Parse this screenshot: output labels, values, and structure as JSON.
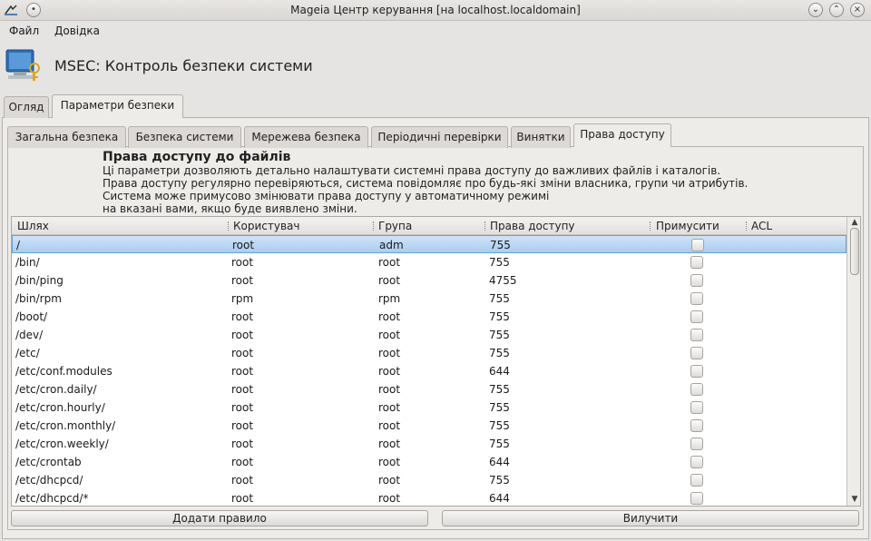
{
  "window": {
    "title": "Mageia Центр керування  [на localhost.localdomain]",
    "controls": [
      "chevron-down-icon",
      "chevron-up-icon",
      "close-icon"
    ]
  },
  "menu": {
    "file": "Файл",
    "help": "Довідка"
  },
  "header": {
    "title": "MSEC: Контроль безпеки системи"
  },
  "outer_tabs": [
    {
      "label": "Огляд"
    },
    {
      "label": "Параметри безпеки"
    }
  ],
  "inner_tabs": [
    {
      "label": "Загальна безпека"
    },
    {
      "label": "Безпека системи"
    },
    {
      "label": "Мережева безпека"
    },
    {
      "label": "Періодичні перевірки"
    },
    {
      "label": "Винятки"
    },
    {
      "label": "Права доступу"
    }
  ],
  "description": {
    "title": "Права доступу до файлів",
    "lines": [
      "Ці параметри дозволяють детально налаштувати системні права доступу до важливих файлів і каталогів.",
      "Права доступу регулярно перевіряються, система повідомляє про будь-які зміни власника, групи чи атрибутів.",
      "Система може примусово змінювати права доступу у автоматичному режимі",
      "на вказані вами, якщо буде виявлено зміни."
    ]
  },
  "table": {
    "columns": [
      "Шлях",
      "Користувач",
      "Група",
      "Права доступу",
      "Примусити",
      "ACL"
    ],
    "rows": [
      {
        "path": "/",
        "user": "root",
        "group": "adm",
        "perm": "755",
        "force": false,
        "acl": ""
      },
      {
        "path": "/bin/",
        "user": "root",
        "group": "root",
        "perm": "755",
        "force": false,
        "acl": ""
      },
      {
        "path": "/bin/ping",
        "user": "root",
        "group": "root",
        "perm": "4755",
        "force": false,
        "acl": ""
      },
      {
        "path": "/bin/rpm",
        "user": "rpm",
        "group": "rpm",
        "perm": "755",
        "force": false,
        "acl": ""
      },
      {
        "path": "/boot/",
        "user": "root",
        "group": "root",
        "perm": "755",
        "force": false,
        "acl": ""
      },
      {
        "path": "/dev/",
        "user": "root",
        "group": "root",
        "perm": "755",
        "force": false,
        "acl": ""
      },
      {
        "path": "/etc/",
        "user": "root",
        "group": "root",
        "perm": "755",
        "force": false,
        "acl": ""
      },
      {
        "path": "/etc/conf.modules",
        "user": "root",
        "group": "root",
        "perm": "644",
        "force": false,
        "acl": ""
      },
      {
        "path": "/etc/cron.daily/",
        "user": "root",
        "group": "root",
        "perm": "755",
        "force": false,
        "acl": ""
      },
      {
        "path": "/etc/cron.hourly/",
        "user": "root",
        "group": "root",
        "perm": "755",
        "force": false,
        "acl": ""
      },
      {
        "path": "/etc/cron.monthly/",
        "user": "root",
        "group": "root",
        "perm": "755",
        "force": false,
        "acl": ""
      },
      {
        "path": "/etc/cron.weekly/",
        "user": "root",
        "group": "root",
        "perm": "755",
        "force": false,
        "acl": ""
      },
      {
        "path": "/etc/crontab",
        "user": "root",
        "group": "root",
        "perm": "644",
        "force": false,
        "acl": ""
      },
      {
        "path": "/etc/dhcpcd/",
        "user": "root",
        "group": "root",
        "perm": "755",
        "force": false,
        "acl": ""
      },
      {
        "path": "/etc/dhcpcd/*",
        "user": "root",
        "group": "root",
        "perm": "644",
        "force": false,
        "acl": ""
      }
    ]
  },
  "buttons": {
    "add_rule": "Додати правило",
    "remove": "Вилучити"
  },
  "colors": {
    "selection": "#a9cdef",
    "panel": "#eeece9",
    "window": "#e6e4e2"
  }
}
